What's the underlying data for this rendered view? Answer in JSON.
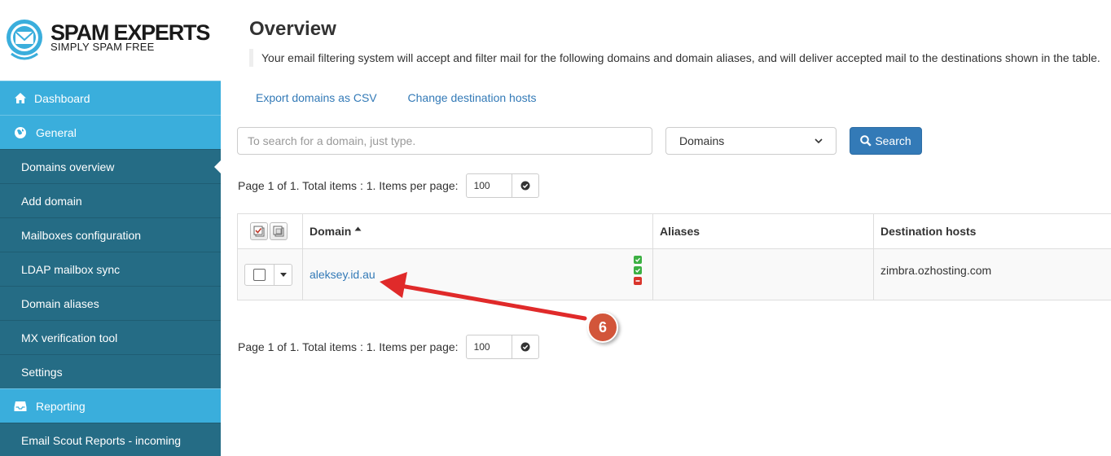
{
  "brand": {
    "title": "SPAM EXPERTS",
    "subtitle": "SIMPLY SPAM FREE",
    "logo_color": "#3aaedc"
  },
  "sidebar": {
    "items": [
      {
        "label": "Dashboard",
        "icon": "home-icon",
        "type": "section"
      },
      {
        "label": "General",
        "icon": "globe-icon",
        "type": "section"
      },
      {
        "label": "Domains overview",
        "type": "sub",
        "active": true
      },
      {
        "label": "Add domain",
        "type": "sub"
      },
      {
        "label": "Mailboxes configuration",
        "type": "sub"
      },
      {
        "label": "LDAP mailbox sync",
        "type": "sub"
      },
      {
        "label": "Domain aliases",
        "type": "sub"
      },
      {
        "label": "MX verification tool",
        "type": "sub"
      },
      {
        "label": "Settings",
        "type": "sub"
      },
      {
        "label": "Reporting",
        "icon": "inbox-icon",
        "type": "section"
      },
      {
        "label": "Email Scout Reports - incoming",
        "type": "sub"
      }
    ]
  },
  "main": {
    "title": "Overview",
    "intro": "Your email filtering system will accept and filter mail for the following domains and domain aliases, and will deliver accepted mail to the destinations shown in the table.",
    "links": {
      "export": "Export domains as CSV",
      "change_dest": "Change destination hosts"
    },
    "search": {
      "placeholder": "To search for a domain, just type.",
      "select_value": "Domains",
      "button": "Search"
    },
    "pager_top": {
      "text": "Page 1 of 1. Total items : 1. Items per page:",
      "per_page": "100"
    },
    "pager_bottom": {
      "text": "Page 1 of 1. Total items : 1. Items per page:",
      "per_page": "100"
    },
    "table": {
      "headers": {
        "domain": "Domain",
        "aliases": "Aliases",
        "destination": "Destination hosts"
      },
      "rows": [
        {
          "domain": "aleksey.id.au",
          "aliases": "",
          "destination": "zimbra.ozhosting.com"
        }
      ]
    }
  },
  "annotation": {
    "number": "6",
    "color": "#e02a2a",
    "badge_color": "#d2553a"
  }
}
